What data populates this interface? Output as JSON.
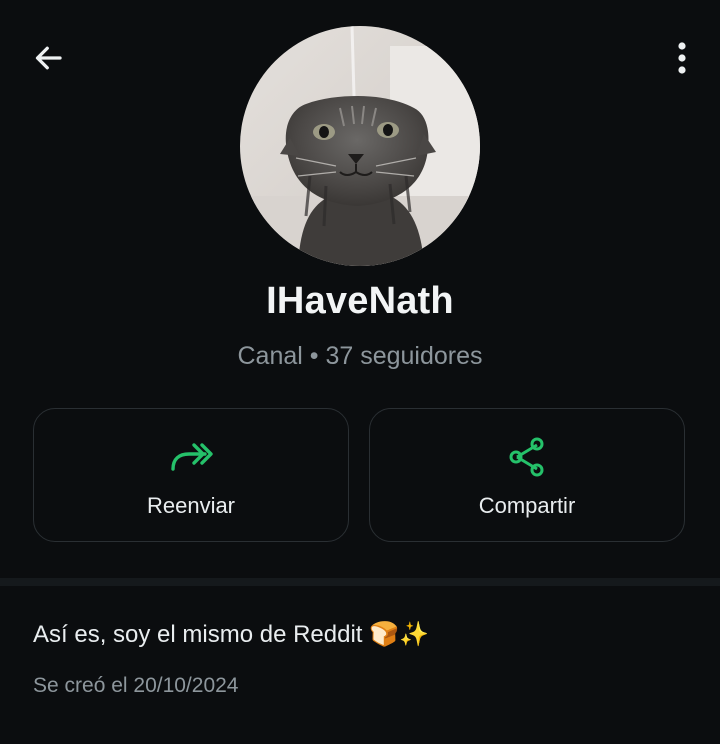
{
  "header": {
    "back_icon": "arrow-left-icon",
    "menu_icon": "more-vertical-icon"
  },
  "channel": {
    "name": "IHaveNath",
    "meta": "Canal • 37 seguidores",
    "avatar": "wet-cat-photo"
  },
  "actions": [
    {
      "label": "Reenviar",
      "icon": "forward-icon"
    },
    {
      "label": "Compartir",
      "icon": "share-icon"
    }
  ],
  "about": {
    "description": "Así es, soy el mismo de Reddit 🍞✨",
    "created": "Se creó el 20/10/2024"
  },
  "colors": {
    "background": "#0b0d0f",
    "accent": "#25c16a",
    "text": "#e9edef",
    "muted": "#8d969c",
    "border": "#2a2f33"
  }
}
